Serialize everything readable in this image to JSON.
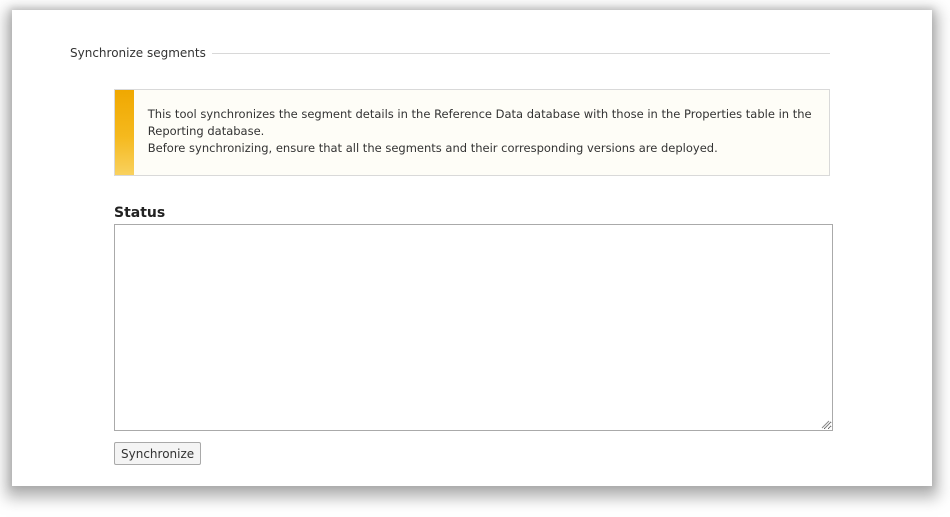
{
  "section": {
    "legend": "Synchronize segments"
  },
  "info": {
    "line1": "This tool synchronizes the segment details in the Reference Data database with those in the Properties table in the Reporting database.",
    "line2": "Before synchronizing, ensure that all the segments and their corresponding versions are deployed.",
    "accent_color": "#f0a800"
  },
  "status": {
    "label": "Status",
    "value": ""
  },
  "actions": {
    "synchronize_label": "Synchronize"
  }
}
